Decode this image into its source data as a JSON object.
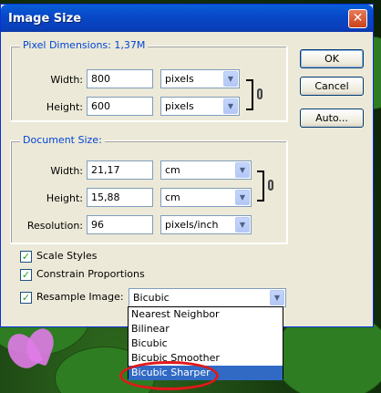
{
  "window": {
    "title": "Image Size",
    "close_glyph": "✕"
  },
  "pixel_dimensions": {
    "legend": "Pixel Dimensions:  1,37M",
    "width_label": "Width:",
    "width_value": "800",
    "width_unit": "pixels",
    "height_label": "Height:",
    "height_value": "600",
    "height_unit": "pixels"
  },
  "document_size": {
    "legend": "Document Size:",
    "width_label": "Width:",
    "width_value": "21,17",
    "width_unit": "cm",
    "height_label": "Height:",
    "height_value": "15,88",
    "height_unit": "cm",
    "resolution_label": "Resolution:",
    "resolution_value": "96",
    "resolution_unit": "pixels/inch"
  },
  "buttons": {
    "ok": "OK",
    "cancel": "Cancel",
    "auto": "Auto..."
  },
  "options": {
    "scale_styles": "Scale Styles",
    "scale_styles_checked": true,
    "constrain_proportions": "Constrain Proportions",
    "constrain_proportions_checked": true,
    "resample_image": "Resample Image:",
    "resample_image_checked": true,
    "resample_value": "Bicubic"
  },
  "resample_options": [
    "Nearest Neighbor",
    "Bilinear",
    "Bicubic",
    "Bicubic Smoother",
    "Bicubic Sharper"
  ],
  "selected_option": "Bicubic Sharper",
  "icons": {
    "dropdown_arrow": "chevron-down-icon",
    "link": "chain-link-icon",
    "check": "checkmark-icon"
  },
  "colors": {
    "title_bar": "#0a5fd8",
    "legend_text": "#0046d5",
    "selection": "#316ac5",
    "highlight_ellipse": "#e21818"
  }
}
